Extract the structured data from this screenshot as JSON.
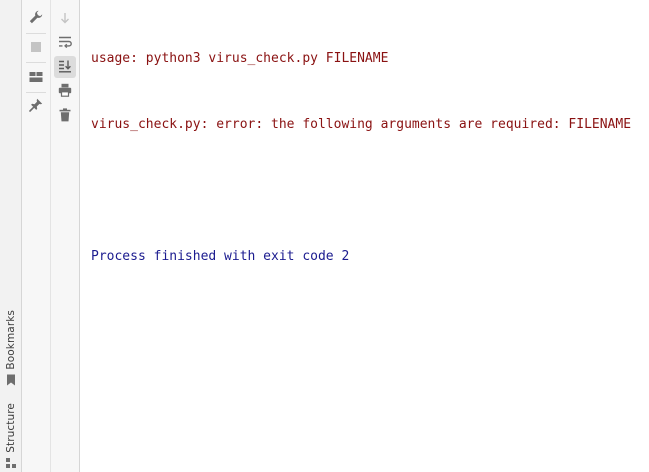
{
  "stripe": {
    "tabs": [
      {
        "label": "Bookmarks",
        "icon": "bookmark-icon"
      },
      {
        "label": "Structure",
        "icon": "structure-icon"
      }
    ]
  },
  "toolbar_left": {
    "buttons": [
      {
        "icon": "wrench-icon",
        "enabled": true
      },
      {
        "icon": "stop-icon",
        "enabled": false
      },
      {
        "icon": "layout-icon",
        "enabled": true
      },
      {
        "icon": "pin-icon",
        "enabled": true
      }
    ]
  },
  "toolbar_right": {
    "buttons": [
      {
        "icon": "arrow-down-icon",
        "enabled": false
      },
      {
        "icon": "soft-wrap-icon",
        "enabled": true
      },
      {
        "icon": "scroll-to-end-icon",
        "enabled": true,
        "active": true
      },
      {
        "icon": "print-icon",
        "enabled": true
      },
      {
        "icon": "trash-icon",
        "enabled": true
      }
    ]
  },
  "console": {
    "lines": [
      {
        "text": "usage: python3 virus_check.py FILENAME",
        "kind": "error"
      },
      {
        "text": "virus_check.py: error: the following arguments are required: FILENAME",
        "kind": "error"
      },
      {
        "text": "",
        "kind": "blank"
      },
      {
        "text": "Process finished with exit code 2",
        "kind": "info"
      }
    ]
  },
  "colors": {
    "error_text": "#8a1212",
    "info_text": "#1b1b8f",
    "icon": "#6e6e6e",
    "icon_disabled": "#c4c4c4"
  }
}
